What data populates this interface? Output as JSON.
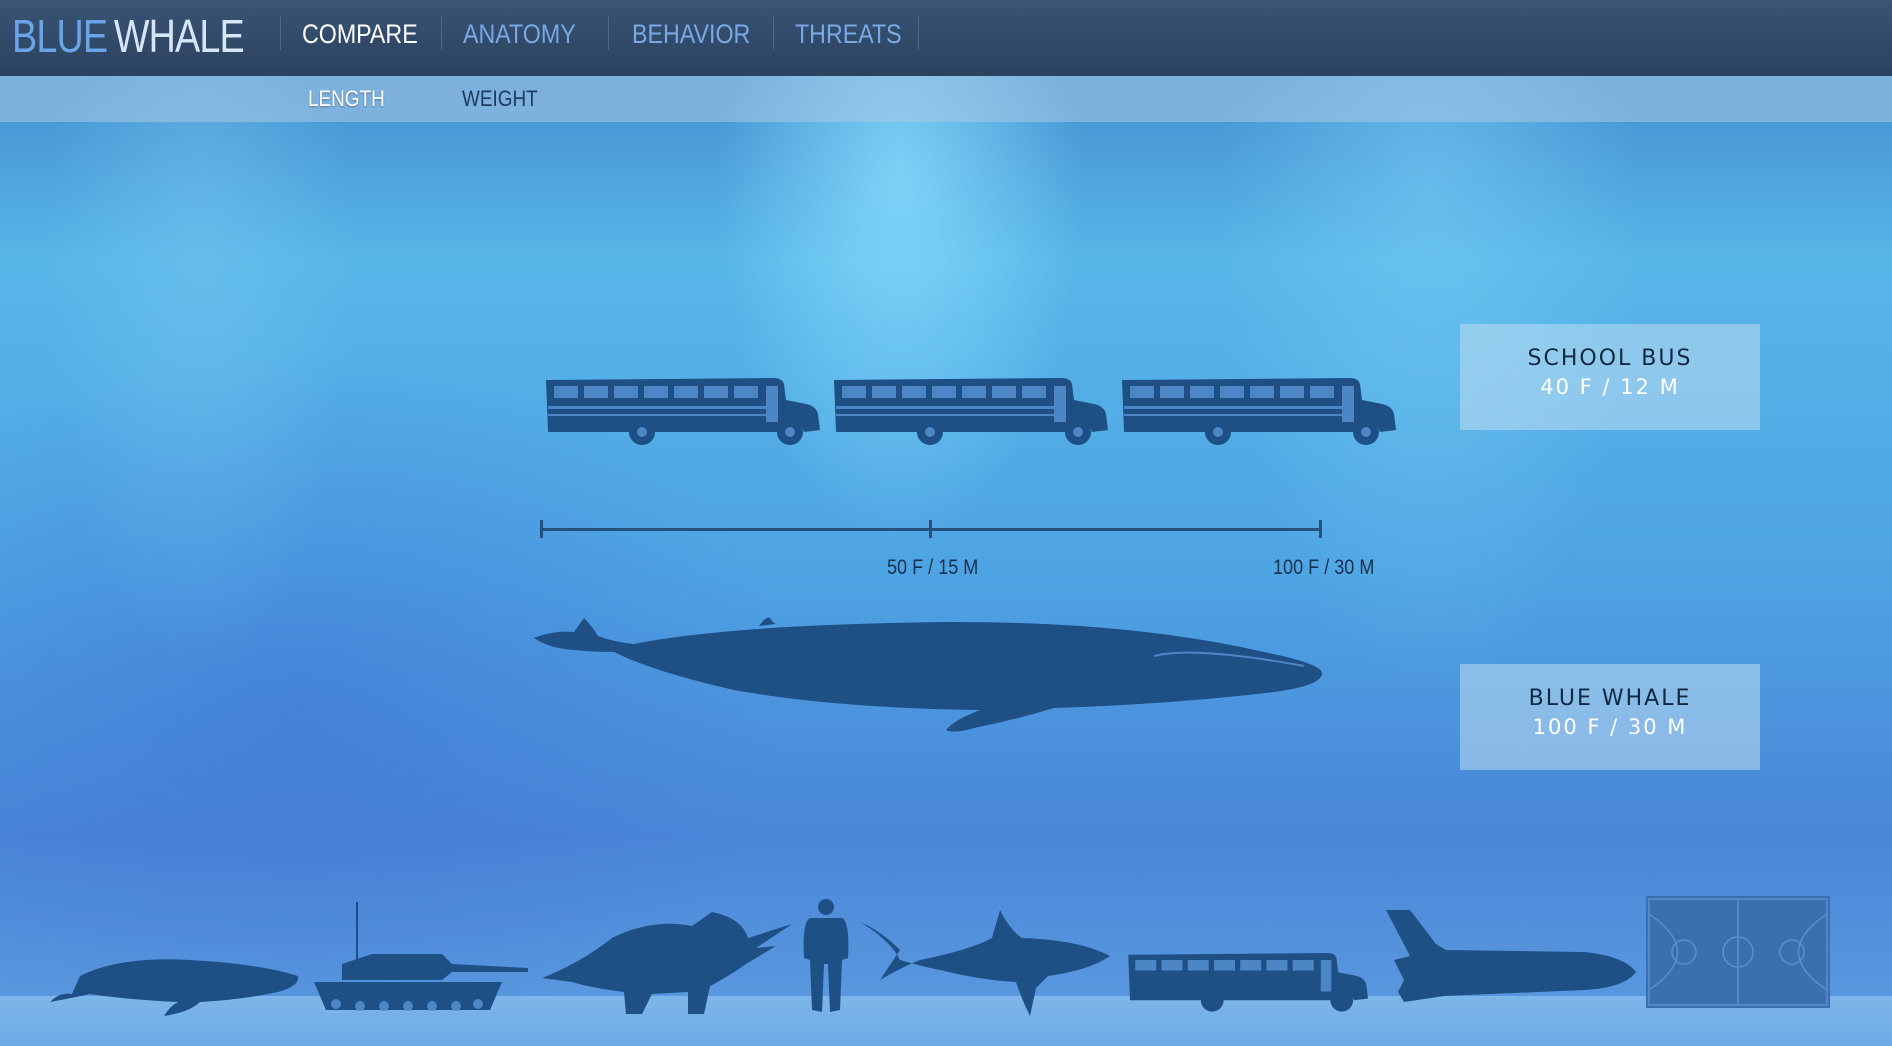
{
  "logo": {
    "blue": "BLUE",
    "whale": "WHALE"
  },
  "nav": {
    "items": [
      {
        "label": "COMPARE",
        "active": true
      },
      {
        "label": "ANATOMY",
        "active": false
      },
      {
        "label": "BEHAVIOR",
        "active": false
      },
      {
        "label": "THREATS",
        "active": false
      }
    ]
  },
  "subnav": {
    "items": [
      {
        "label": "LENGTH",
        "active": true
      },
      {
        "label": "WEIGHT",
        "active": false
      }
    ]
  },
  "comparison": {
    "school_bus": {
      "title": "SCHOOL BUS",
      "value": "40 F / 12 M",
      "count": 3
    },
    "blue_whale": {
      "title": "BLUE WHALE",
      "value": "100 F / 30 M"
    }
  },
  "scale": {
    "mid_label": "50 F / 15 M",
    "end_label": "100 F / 30 M"
  },
  "compare_options": [
    {
      "icon": "humpback-whale-icon"
    },
    {
      "icon": "tank-icon"
    },
    {
      "icon": "triceratops-icon"
    },
    {
      "icon": "person-icon"
    },
    {
      "icon": "shark-icon"
    },
    {
      "icon": "school-bus-icon"
    },
    {
      "icon": "space-shuttle-icon"
    },
    {
      "icon": "basketball-court-icon"
    }
  ],
  "colors": {
    "accent": "#6aa4e8",
    "silhouette": "#1e4f85",
    "nav_bg": "#2b425f"
  }
}
